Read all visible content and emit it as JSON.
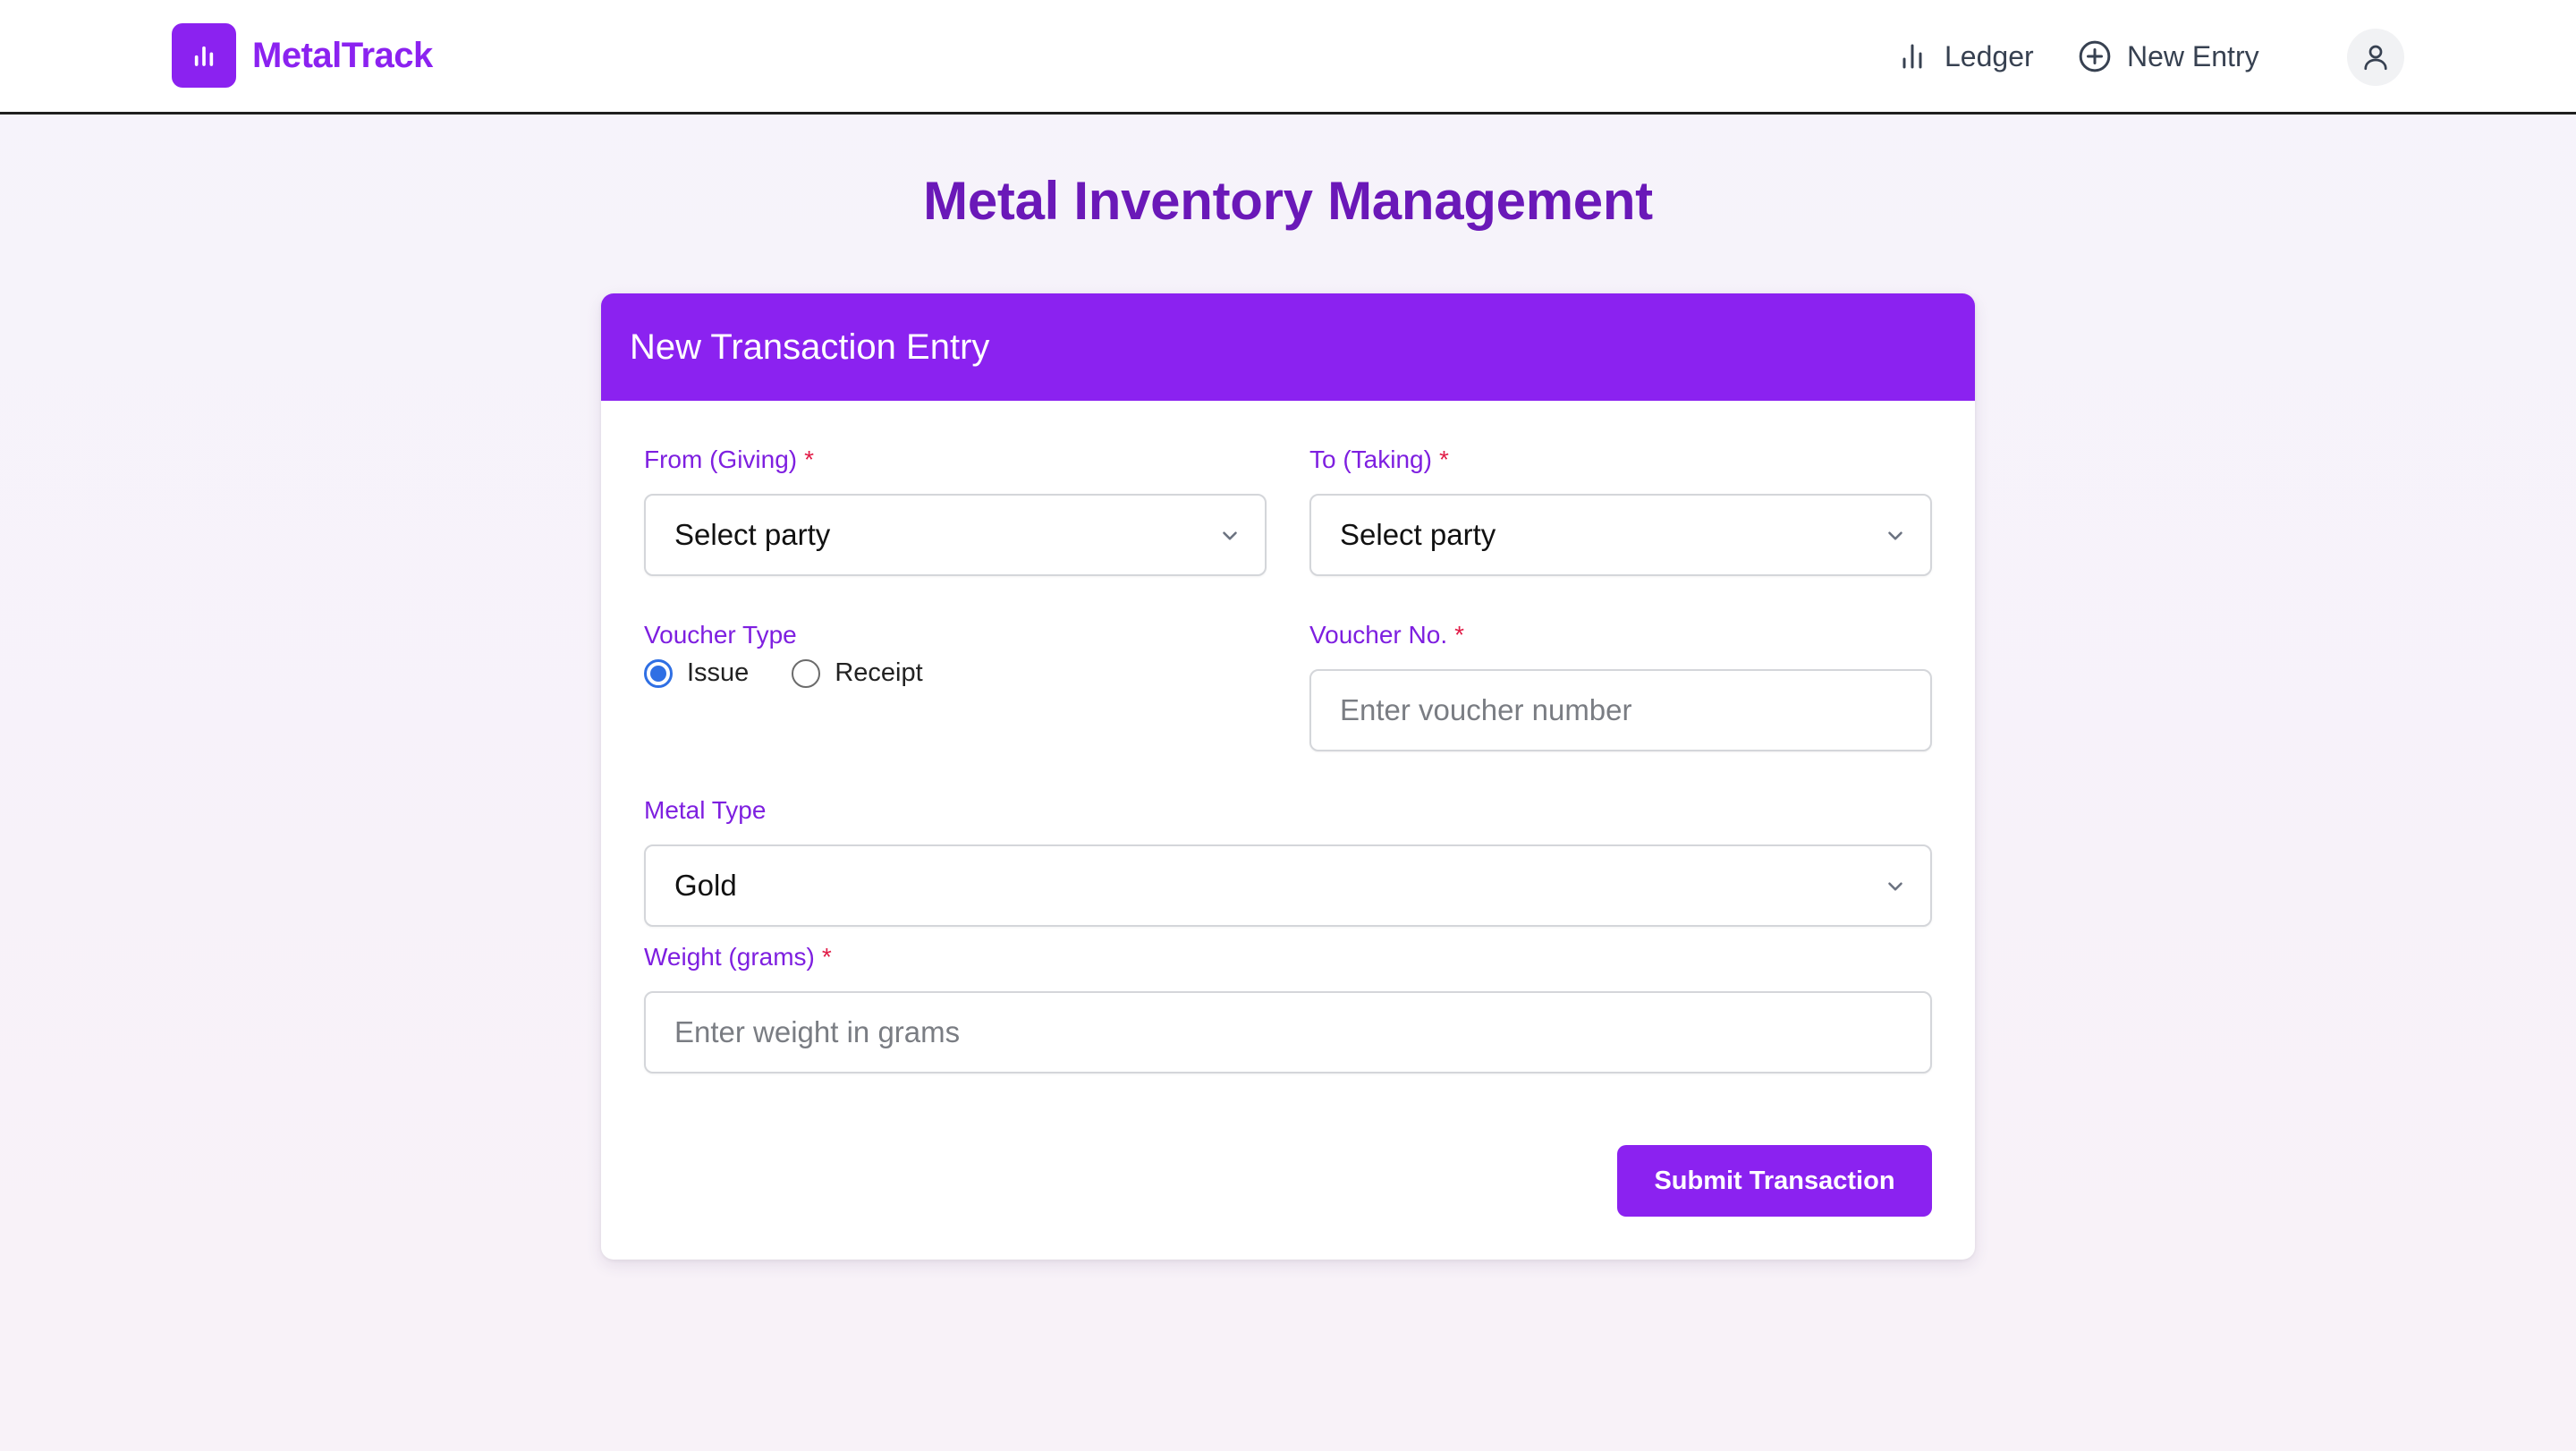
{
  "app": {
    "name": "MetalTrack"
  },
  "nav": {
    "ledger_label": "Ledger",
    "new_entry_label": "New Entry"
  },
  "page": {
    "title": "Metal Inventory Management"
  },
  "form": {
    "title": "New Transaction Entry",
    "required_marker": "*",
    "from": {
      "label": "From (Giving)",
      "selected": "Select party"
    },
    "to": {
      "label": "To (Taking)",
      "selected": "Select party"
    },
    "voucher_type": {
      "label": "Voucher Type",
      "options": [
        "Issue",
        "Receipt"
      ],
      "selected": "Issue"
    },
    "voucher_no": {
      "label": "Voucher No.",
      "value": "",
      "placeholder": "Enter voucher number"
    },
    "metal_type": {
      "label": "Metal Type",
      "selected": "Gold"
    },
    "weight": {
      "label": "Weight (grams)",
      "value": "",
      "placeholder": "Enter weight in grams"
    },
    "submit_label": "Submit Transaction"
  },
  "colors": {
    "brand": "#8b22f0",
    "title": "#6a18b8",
    "label": "#7e1fe0",
    "required": "#e11d48",
    "radio_selected": "#2f6fe4"
  },
  "icons": {
    "logo": "bar-chart-icon",
    "ledger": "bar-chart-icon",
    "new_entry": "plus-circle-icon",
    "avatar": "user-icon",
    "select": "chevron-down-icon"
  }
}
